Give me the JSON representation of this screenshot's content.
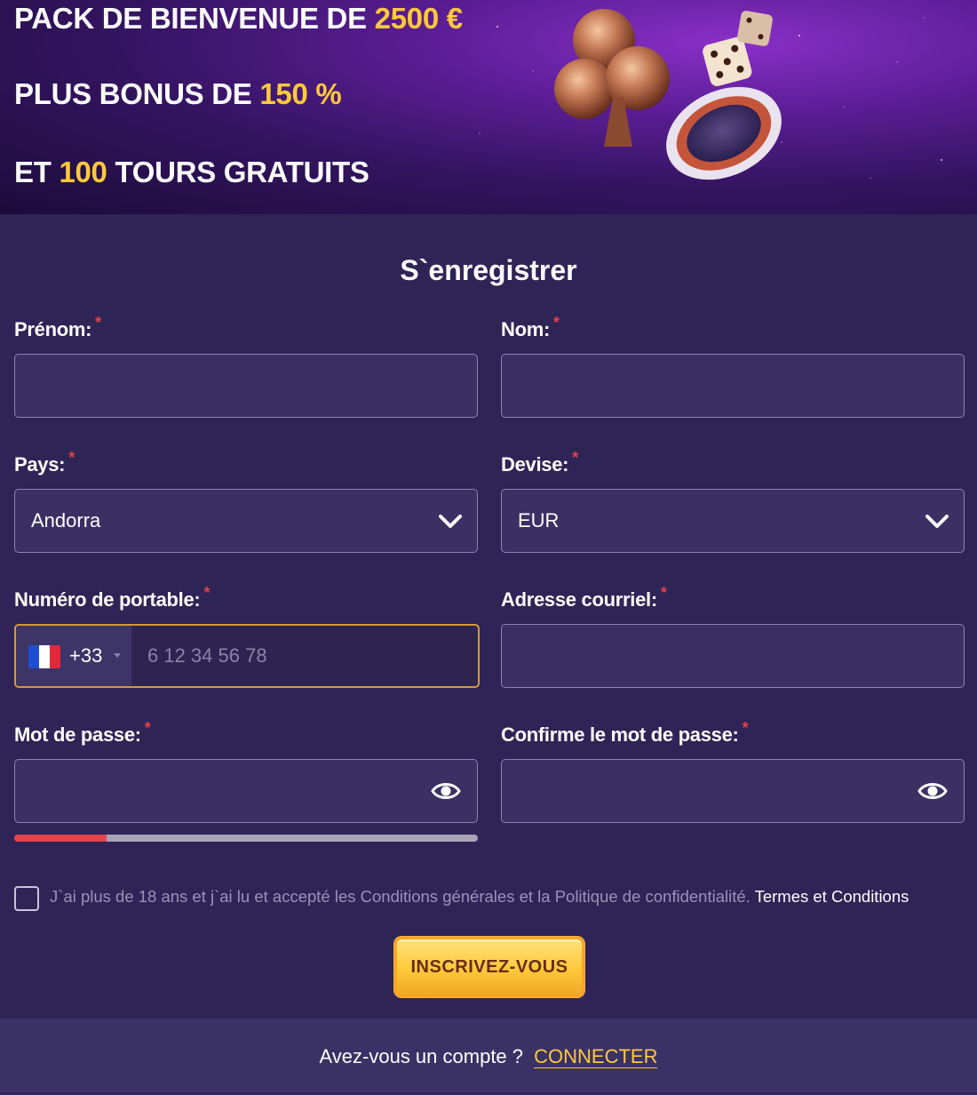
{
  "banner": {
    "line1_prefix": "PACK DE BIENVENUE DE",
    "line1_highlight": "2500 €",
    "line2_prefix": "PLUS BONUS DE",
    "line2_highlight": "150 %",
    "line3_prefix": "ET",
    "line3_highlight": "100",
    "line3_suffix": "TOURS GRATUITS",
    "art_icon": "casino-club-chip-dice-illustration"
  },
  "form": {
    "title": "S`enregistrer",
    "required_mark": "*",
    "first_name": {
      "label": "Prénom:",
      "value": ""
    },
    "last_name": {
      "label": "Nom:",
      "value": ""
    },
    "country": {
      "label": "Pays:",
      "selected": "Andorra"
    },
    "currency": {
      "label": "Devise:",
      "selected": "EUR"
    },
    "phone": {
      "label": "Numéro de portable:",
      "country_code": "+33",
      "flag": "france-flag-icon",
      "placeholder": "6 12 34 56 78",
      "value": ""
    },
    "email": {
      "label": "Adresse courriel:",
      "value": ""
    },
    "password": {
      "label": "Mot de passe:",
      "value": "",
      "strength": 0.2
    },
    "confirm_password": {
      "label": "Confirme le mot de passe:",
      "value": ""
    },
    "terms": {
      "text": "J`ai plus de 18 ans et j`ai lu et accepté les Conditions générales et la Politique de confidentialité.",
      "link": "Termes et Conditions",
      "checked": false
    },
    "submit_label": "INSCRIVEZ-VOUS"
  },
  "footer": {
    "text": "Avez-vous un compte ?",
    "link": "CONNECTER"
  },
  "colors": {
    "background": "#2e2456",
    "accent": "#ffc93a",
    "required": "#e4434a",
    "strength_weak": "#e2434c"
  }
}
